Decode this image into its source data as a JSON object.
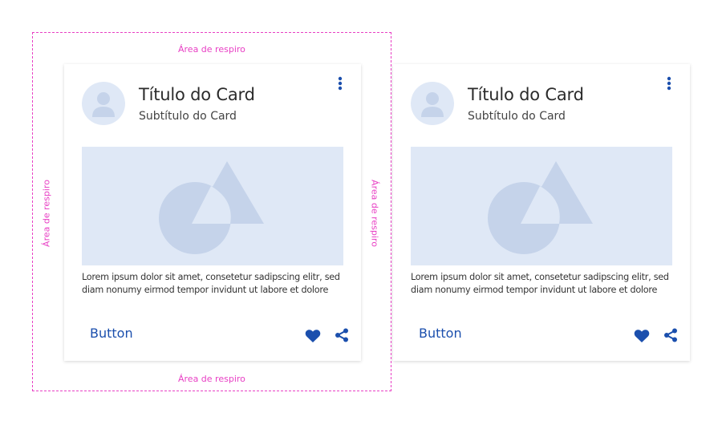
{
  "annotations": {
    "top": "Área de respiro",
    "bottom": "Área de respiro",
    "left": "Área de respiro",
    "right": "Área de respiro",
    "color": "#e83fc4"
  },
  "cards": [
    {
      "title": "Título do Card",
      "subtitle": "Subtítulo do Card",
      "body": "Lorem ipsum dolor sit amet, consetetur sadipscing elitr, sed diam nonumy eirmod tempor invidunt ut labore et dolore",
      "button_label": "Button",
      "icons": [
        "more-vertical-icon",
        "heart-icon",
        "share-icon",
        "user-avatar-icon",
        "image-placeholder-icon"
      ]
    },
    {
      "title": "Título do Card",
      "subtitle": "Subtítulo do Card",
      "body": "Lorem ipsum dolor sit amet, consetetur sadipscing elitr, sed diam nonumy eirmod tempor invidunt ut labore et dolore",
      "button_label": "Button",
      "icons": [
        "more-vertical-icon",
        "heart-icon",
        "share-icon",
        "user-avatar-icon",
        "image-placeholder-icon"
      ]
    }
  ],
  "colors": {
    "accent": "#1b4fad",
    "placeholder_bg": "#dfe8f6",
    "placeholder_shape": "#c5d3ea",
    "annotation": "#e83fc4"
  }
}
